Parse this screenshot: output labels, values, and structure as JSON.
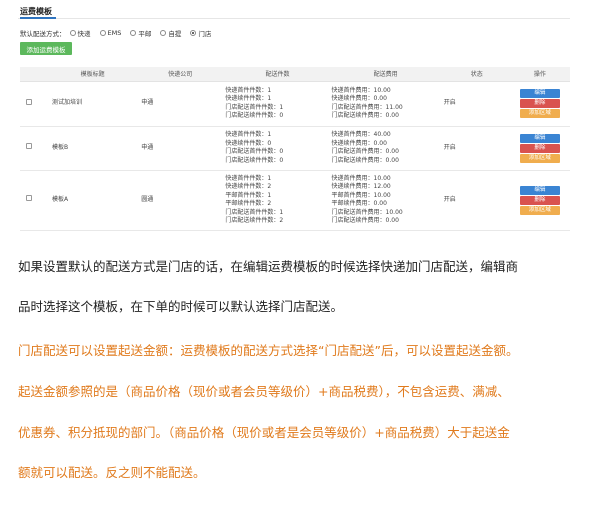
{
  "panel": {
    "title": "运费模板",
    "default_label": "默认配送方式：",
    "options": [
      {
        "label": "快递",
        "checked": false
      },
      {
        "label": "EMS",
        "checked": false
      },
      {
        "label": "平邮",
        "checked": false
      },
      {
        "label": "自提",
        "checked": false
      },
      {
        "label": "门店",
        "checked": true
      }
    ],
    "add_button": "添加运费模板"
  },
  "table": {
    "headers": [
      "模板标题",
      "快递公司",
      "配送件数",
      "配送费用",
      "状态",
      "操作"
    ],
    "rows": [
      {
        "name": "测试加培训",
        "company": "申通",
        "counts": [
          "快递首件件数：1",
          "快递续件件数：1",
          "门店配送首件件数：1",
          "门店配送续件件数：0"
        ],
        "fees": [
          "快递首件费用：10.00",
          "快递续件费用：0.00",
          "门店配送首件费用：11.00",
          "门店配送续件费用：0.00"
        ],
        "status": "开启"
      },
      {
        "name": "模板B",
        "company": "申通",
        "counts": [
          "快递首件件数：1",
          "快递续件件数：0",
          "门店配送首件件数：0",
          "门店配送续件件数：0"
        ],
        "fees": [
          "快递首件费用：40.00",
          "快递续件费用：0.00",
          "门店配送首件费用：0.00",
          "门店配送续件费用：0.00"
        ],
        "status": "开启"
      },
      {
        "name": "模板A",
        "company": "圆通",
        "counts": [
          "快递首件件数：1",
          "快递续件件数：2",
          "平邮首件件数：1",
          "平邮续件件数：2",
          "门店配送首件件数：1",
          "门店配送续件件数：2"
        ],
        "fees": [
          "快递首件费用：10.00",
          "快递续件费用：12.00",
          "平邮首件费用：10.00",
          "平邮续件费用：0.00",
          "门店配送首件费用：10.00",
          "门店配送续件费用：0.00"
        ],
        "status": "开启"
      }
    ],
    "ops": {
      "edit": "编辑",
      "delete": "删除",
      "add_area": "添加区域"
    }
  },
  "text": {
    "p1_line1": "如果设置默认的配送方式是门店的话，在编辑运费模板的时候选择快递加门店配送，编辑商",
    "p1_line2": "品时选择这个模板，在下单的时候可以默认选择门店配送。",
    "o_line1": "门店配送可以设置起送金额：运费模板的配送方式选择“门店配送”后，可以设置起送金额。",
    "o_line2": "起送金额参照的是（商品价格（现价或者会员等级价）+商品税费），不包含运费、满减、",
    "o_line3": "优惠券、积分抵现的部门。（商品价格（现价或者是会员等级价）+商品税费）大于起送金",
    "o_line4": "额就可以配送。反之则不能配送。"
  },
  "colors": {
    "accent_blue": "#3a84d3",
    "add_green": "#5cb85c",
    "delete_red": "#d9534f",
    "area_orange": "#f0ad4e",
    "note_orange": "#e07a1c"
  }
}
